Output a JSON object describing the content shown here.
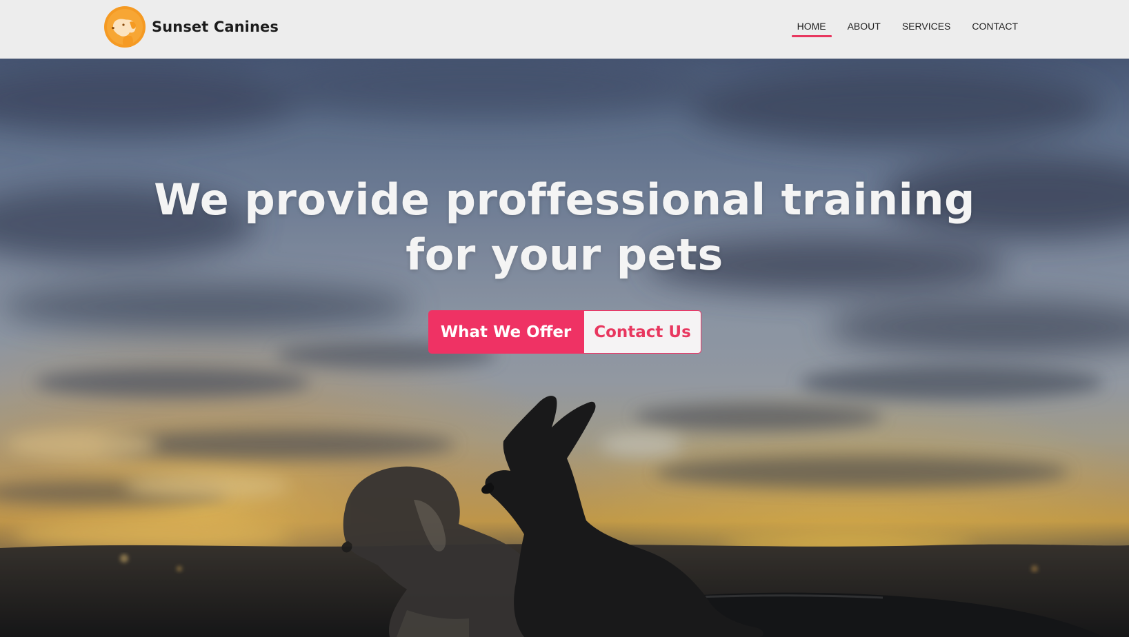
{
  "brand": {
    "name": "Sunset Canines",
    "logo_icon": "dog-sun-logo-icon",
    "logo_color": "#f59a23"
  },
  "nav": {
    "items": [
      {
        "label": "HOME",
        "active": true
      },
      {
        "label": "ABOUT",
        "active": false
      },
      {
        "label": "SERVICES",
        "active": false
      },
      {
        "label": "CONTACT",
        "active": false
      }
    ],
    "active_color": "#e8375f"
  },
  "hero": {
    "title_line1": "We provide proffessional training",
    "title_line2": "for your pets",
    "background": "sunset-sky-with-two-dogs-silhouette"
  },
  "cta": {
    "primary_label": "What We Offer",
    "secondary_label": "Contact Us",
    "accent_color": "#ef3264"
  }
}
